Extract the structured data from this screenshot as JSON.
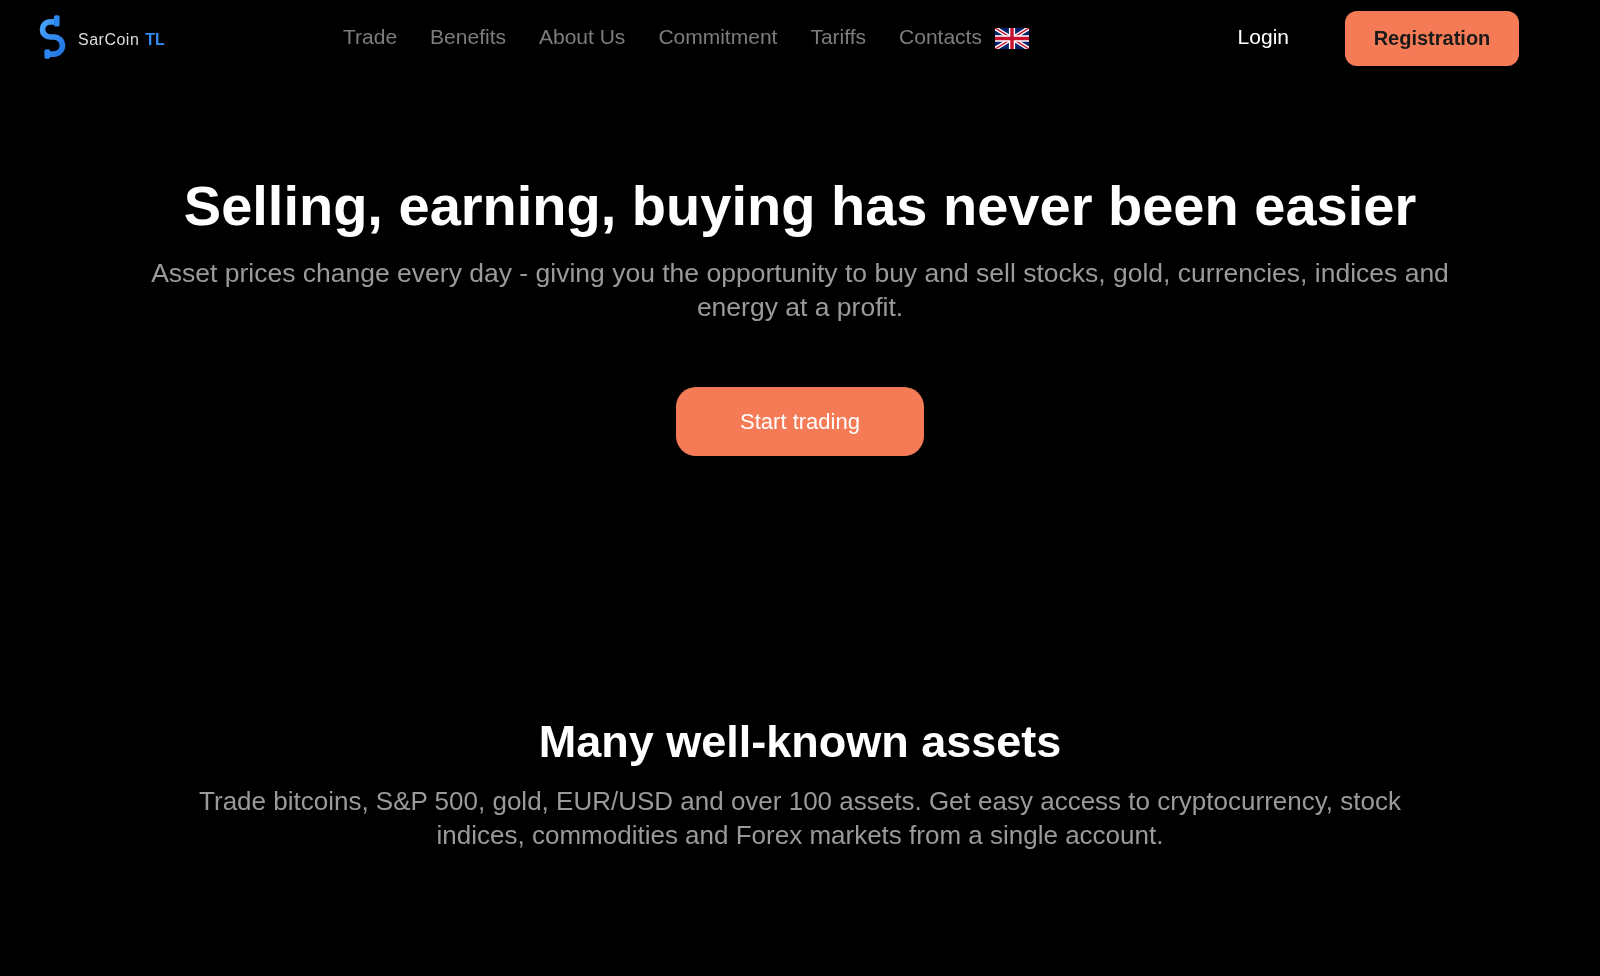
{
  "header": {
    "brand": {
      "name": "SarCoin",
      "suffix": "TL"
    },
    "nav": [
      {
        "label": "Trade"
      },
      {
        "label": "Benefits"
      },
      {
        "label": "About Us"
      },
      {
        "label": "Commitment"
      },
      {
        "label": "Tariffs"
      },
      {
        "label": "Contacts"
      }
    ],
    "login": "Login",
    "register": "Registration"
  },
  "hero": {
    "title": "Selling, earning, buying has never been easier",
    "subtitle": "Asset prices change every day - giving you the opportunity to buy and sell stocks, gold, currencies, indices and energy at a profit.",
    "cta": "Start trading"
  },
  "assets": {
    "title": "Many well-known assets",
    "text": "Trade bitcoins, S&P 500, gold, EUR/USD and over 100 assets. Get easy access to cryptocurrency, stock indices, commodities and Forex markets from a single account."
  }
}
